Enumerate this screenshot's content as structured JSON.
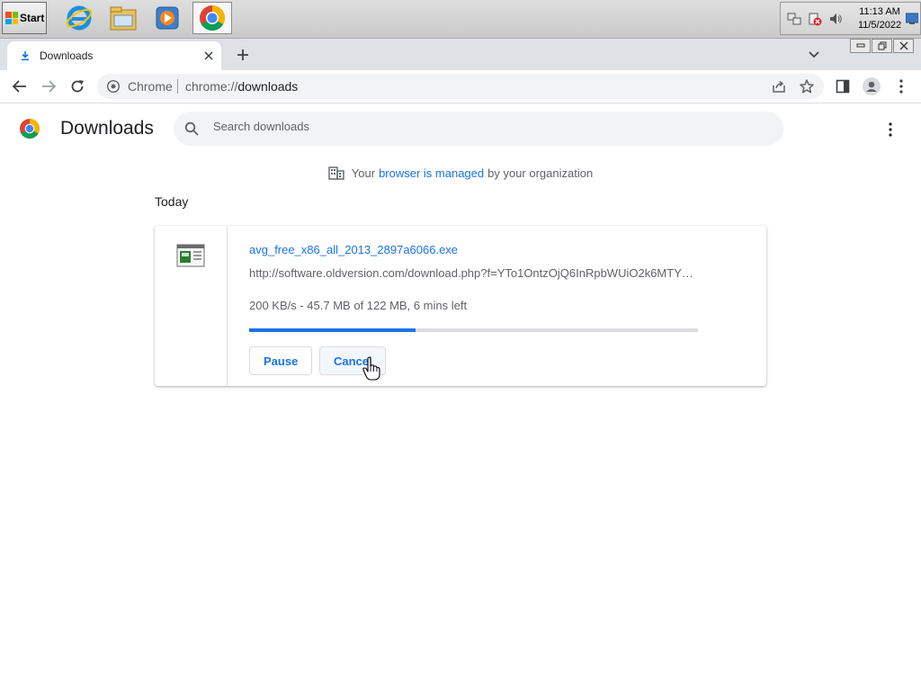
{
  "taskbar": {
    "start_label": "Start",
    "apps": [
      {
        "name": "internet-explorer",
        "icon": "ie-icon"
      },
      {
        "name": "file-explorer",
        "icon": "folder-icon"
      },
      {
        "name": "media-player",
        "icon": "media-player-icon"
      },
      {
        "name": "chrome",
        "icon": "chrome-icon",
        "active": true
      }
    ],
    "clock_time": "11:13 AM",
    "clock_date": "11/5/2022"
  },
  "browser": {
    "tab_title": "Downloads",
    "omnibox_site": "Chrome",
    "omnibox_url_scheme": "chrome://",
    "omnibox_url_path": "downloads"
  },
  "page": {
    "title": "Downloads",
    "search_placeholder": "Search downloads",
    "managed_prefix": "Your",
    "managed_link": "browser is managed",
    "managed_suffix": "by your organization",
    "date_heading": "Today"
  },
  "download": {
    "file_name": "avg_free_x86_all_2013_2897a6066.exe",
    "url": "http://software.oldversion.com/download.php?f=YTo1OntzOjQ6InRpbWUiO2k6MTY2NzY0",
    "status": "200 KB/s - 45.7 MB of 122 MB, 6 mins left",
    "progress_percent": 37,
    "pause_label": "Pause",
    "cancel_label": "Cancel"
  },
  "colors": {
    "accent": "#1a73e8",
    "tab_strip": "#dee1e6"
  }
}
